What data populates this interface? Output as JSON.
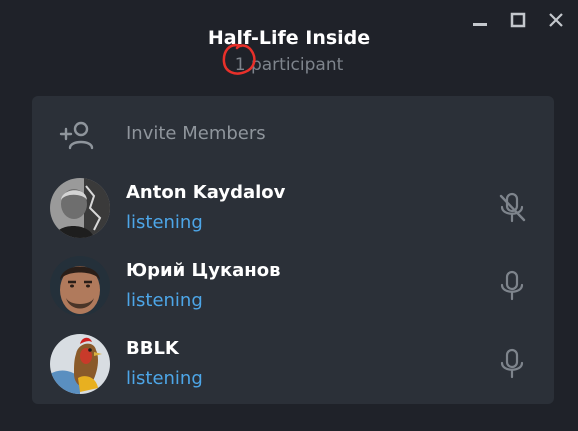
{
  "window": {
    "title": "Half-Life Inside",
    "subtitle": "1 participant"
  },
  "invite": {
    "label": "Invite Members",
    "icon": "add-user-icon"
  },
  "participants": [
    {
      "name": "Anton Kaydalov",
      "status": "listening",
      "mic": "mic-muted-icon"
    },
    {
      "name": "Юрий Цуканов",
      "status": "listening",
      "mic": "mic-icon"
    },
    {
      "name": "BBLK",
      "status": "listening",
      "mic": "mic-icon"
    }
  ],
  "colors": {
    "background": "#1f2229",
    "panel": "#2b3038",
    "status": "#4da6e8",
    "muted_text": "#7e848c",
    "annotation": "#e8302a"
  }
}
